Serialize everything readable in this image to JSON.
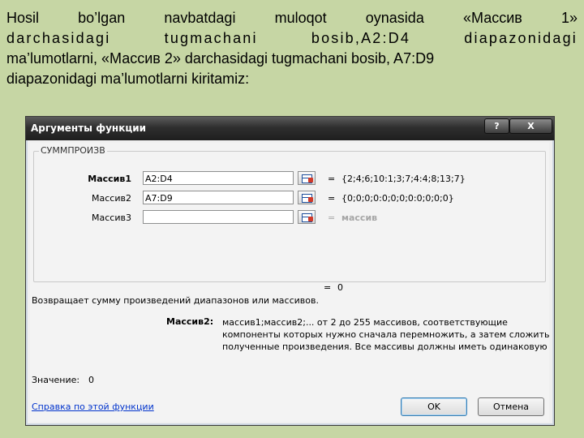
{
  "slide": {
    "line1": "Hosil bo’lgan navbatdagi muloqot oynasida «Массив 1»",
    "line2": "darchasidagi tugmachani bosib,A2:D4 diapazonidagi",
    "line3": "ma’lumotlarni, «Массив 2» darchasidagi tugmachani bosib, A7:D9",
    "line4": "diapazonidagi ma’lumotlarni kiritamiz:"
  },
  "dialog": {
    "title": "Аргументы функции",
    "help_symbol": "?",
    "close_symbol": "X",
    "function_name": "СУММПРОИЗВ",
    "args": [
      {
        "label": "Массив1",
        "value": "A2:D4",
        "result": "{2;4;6;10:1;3;7;4:4;8;13;7}"
      },
      {
        "label": "Массив2",
        "value": "A7:D9",
        "result": "{0;0;0;0:0;0;0;0:0;0;0;0}"
      },
      {
        "label": "Массив3",
        "value": "",
        "result": "массив"
      }
    ],
    "equals": "=",
    "result_value": "0",
    "description": "Возвращает сумму произведений диапазонов или массивов.",
    "arg_help_name": "Массив2:",
    "arg_help_lines": [
      "массив1;массив2;... от 2 до 255 массивов, соответствующие",
      "компоненты которых нужно сначала перемножить, а затем сложить",
      "полученные произведения. Все массивы должны иметь одинаковую"
    ],
    "value_label": "Значение:",
    "value": "0",
    "help_link": "Справка по этой функции",
    "ok_label": "OK",
    "cancel_label": "Отмена"
  }
}
